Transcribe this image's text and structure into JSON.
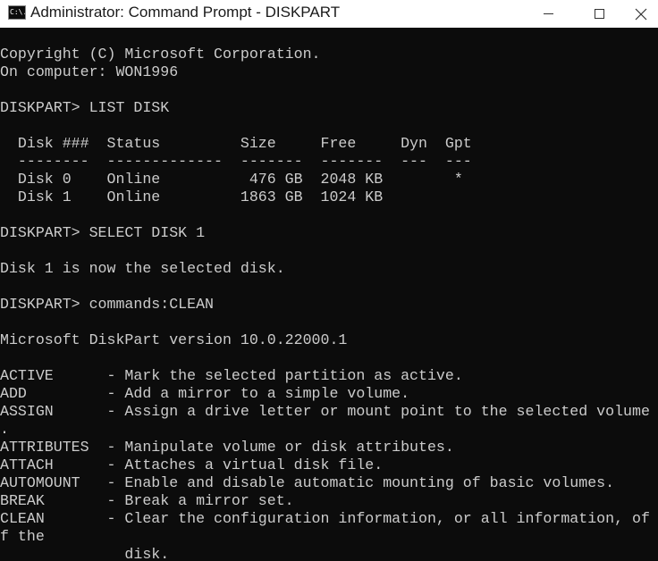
{
  "window": {
    "app_icon_text": "C:\\.",
    "title": "Administrator: Command Prompt - DISKPART"
  },
  "console": {
    "lines": [
      "",
      "Copyright (C) Microsoft Corporation.",
      "On computer: WON1996",
      "",
      "DISKPART> LIST DISK",
      "",
      "  Disk ###  Status         Size     Free     Dyn  Gpt",
      "  --------  -------------  -------  -------  ---  ---",
      "  Disk 0    Online          476 GB  2048 KB        *",
      "  Disk 1    Online         1863 GB  1024 KB",
      "",
      "DISKPART> SELECT DISK 1",
      "",
      "Disk 1 is now the selected disk.",
      "",
      "DISKPART> commands:CLEAN",
      "",
      "Microsoft DiskPart version 10.0.22000.1",
      "",
      "ACTIVE      - Mark the selected partition as active.",
      "ADD         - Add a mirror to a simple volume.",
      "ASSIGN      - Assign a drive letter or mount point to the selected volume",
      ".",
      "ATTRIBUTES  - Manipulate volume or disk attributes.",
      "ATTACH      - Attaches a virtual disk file.",
      "AUTOMOUNT   - Enable and disable automatic mounting of basic volumes.",
      "BREAK       - Break a mirror set.",
      "CLEAN       - Clear the configuration information, or all information, of",
      "f the",
      "              disk."
    ]
  }
}
